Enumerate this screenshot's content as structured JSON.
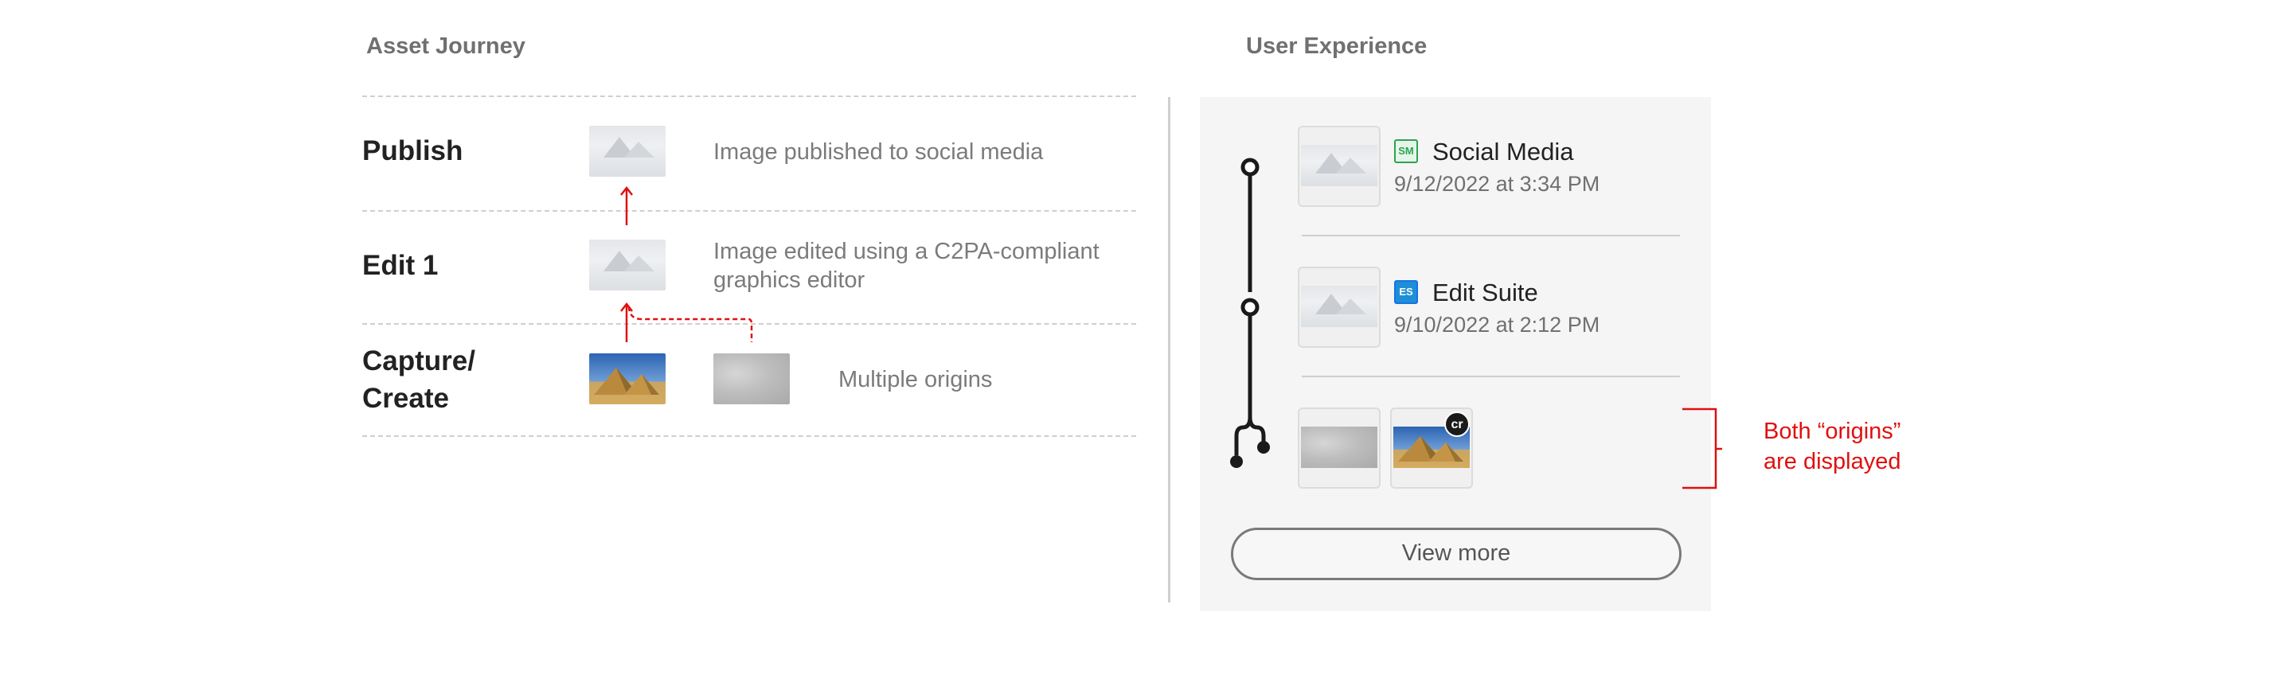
{
  "left": {
    "title": "Asset Journey",
    "rows": [
      {
        "label": "Publish",
        "description": "Image published to social media"
      },
      {
        "label": "Edit 1",
        "description_line1": "Image edited using a C2PA-compliant",
        "description_line2": "graphics editor"
      },
      {
        "label_line1": "Capture/",
        "label_line2": "Create",
        "description": "Multiple origins"
      }
    ]
  },
  "right": {
    "title": "User Experience",
    "entries": [
      {
        "badge": "SM",
        "name": "Social Media",
        "timestamp": "9/12/2022 at 3:34 PM"
      },
      {
        "badge": "ES",
        "name": "Edit Suite",
        "timestamp": "9/10/2022 at 2:12 PM"
      }
    ],
    "cr_badge": "cr",
    "view_more": "View more"
  },
  "annotation": {
    "line1": "Both “origins”",
    "line2": "are displayed"
  },
  "colors": {
    "accent": "#e01010",
    "sm_badge": "#2ea44f",
    "es_badge": "#1e8fd6",
    "panel": "#f5f5f5"
  },
  "icons": [
    "pyramids-thumbnail",
    "cloud-thumbnail",
    "snow-mountain-thumbnail",
    "content-credentials-cr-icon",
    "timeline-branch-icon"
  ]
}
